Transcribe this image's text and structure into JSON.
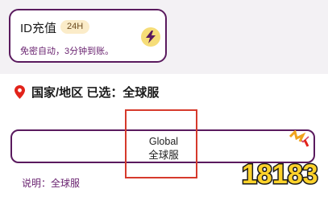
{
  "topup_card": {
    "title": "ID充值",
    "badge": "24H",
    "description": "免密自动，3分钟到账。"
  },
  "region": {
    "label": "国家/地区 已选：全球服",
    "options": [
      {
        "line1": "Global",
        "line2": "全球服",
        "selected": true
      }
    ],
    "note": "说明：全球服"
  },
  "watermark": {
    "text": "18183"
  },
  "colors": {
    "primary": "#5a1a5e",
    "accent_yellow": "#f6dd78",
    "badge_bg": "#fbecc9",
    "pin_red": "#e2231a",
    "annotation_red": "#d63a2c"
  }
}
